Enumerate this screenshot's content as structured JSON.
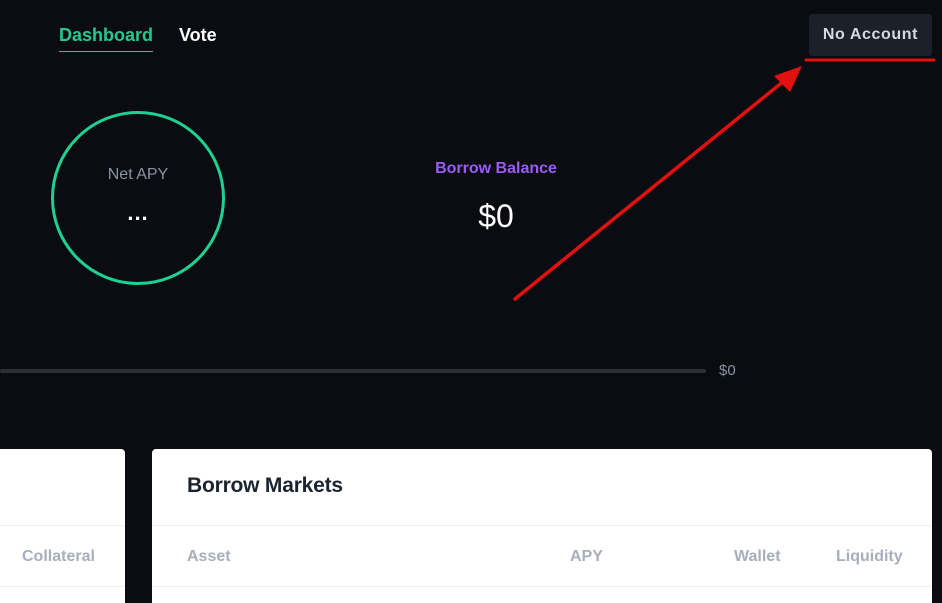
{
  "nav": {
    "dashboard": "Dashboard",
    "vote": "Vote",
    "account_button": "No Account"
  },
  "summary": {
    "net_apy_label": "Net APY",
    "net_apy_value": "...",
    "borrow_balance_label": "Borrow Balance",
    "borrow_balance_value": "$0",
    "borrow_limit_value": "$0"
  },
  "left_card": {
    "columns": [
      "Collateral"
    ]
  },
  "borrow_markets": {
    "title": "Borrow Markets",
    "columns": [
      "Asset",
      "APY",
      "Wallet",
      "Liquidity"
    ]
  },
  "colors": {
    "background": "#0a0c11",
    "accent_green": "#27c78e",
    "accent_purple": "#9b5cf6",
    "annotation_red": "#e31010"
  }
}
